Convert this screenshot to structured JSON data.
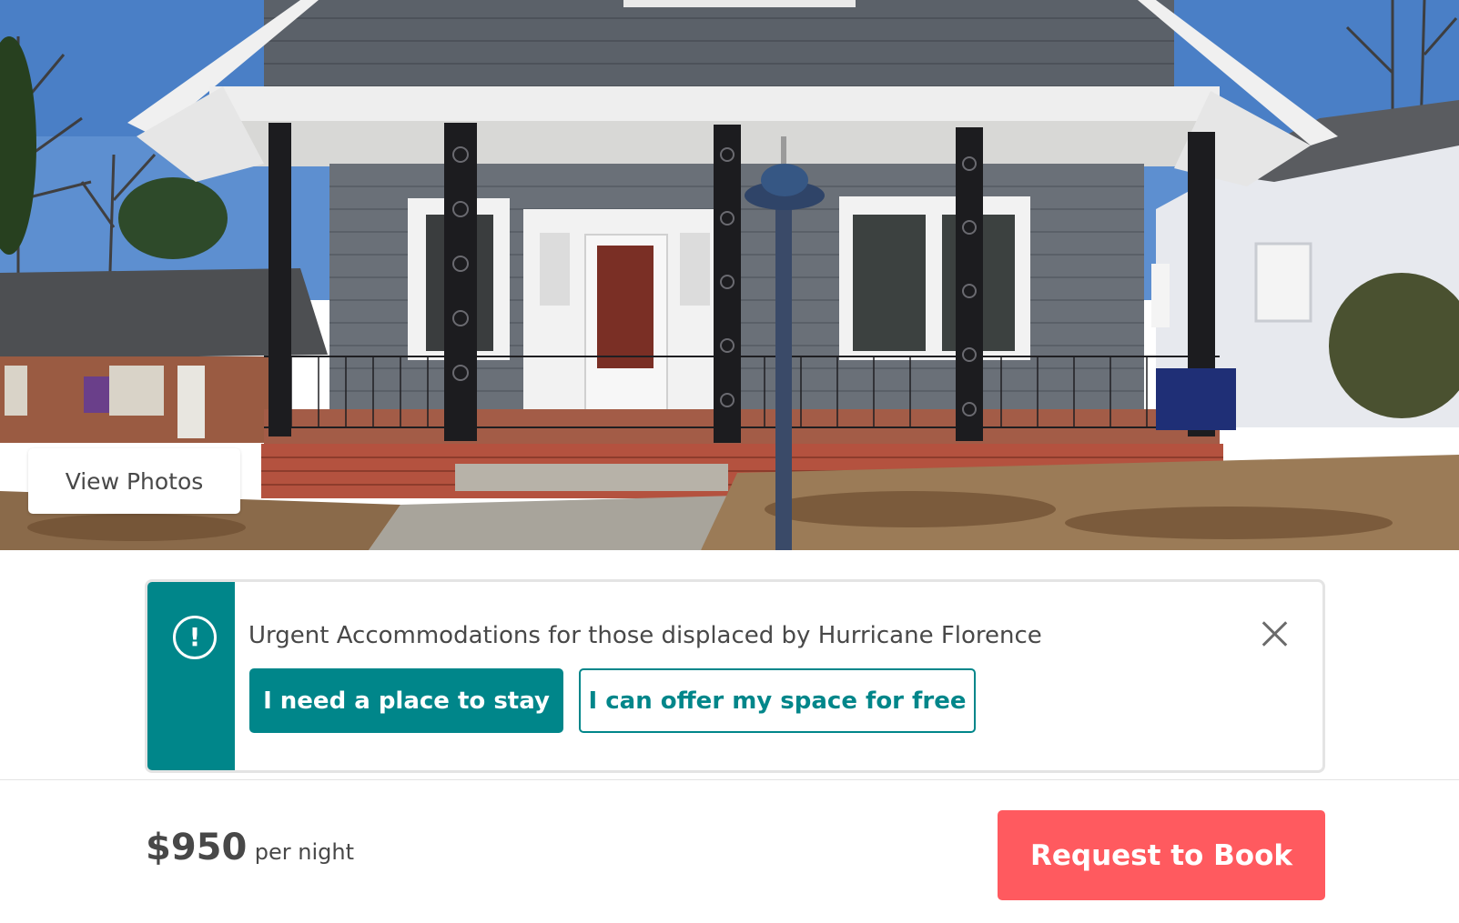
{
  "hero": {
    "view_photos_label": "View Photos"
  },
  "alert": {
    "icon": "exclamation-circle-icon",
    "message": "Urgent Accommodations for those displaced by Hurricane Florence",
    "need_place_label": "I need a place to stay",
    "offer_space_label": "I can offer my space for free",
    "close_icon": "close-icon"
  },
  "booking": {
    "price": "$950",
    "price_unit": "per night",
    "request_label": "Request to Book"
  },
  "colors": {
    "teal": "#00868a",
    "coral": "#ff5a5f",
    "text": "#484848",
    "border": "#e4e4e4"
  }
}
